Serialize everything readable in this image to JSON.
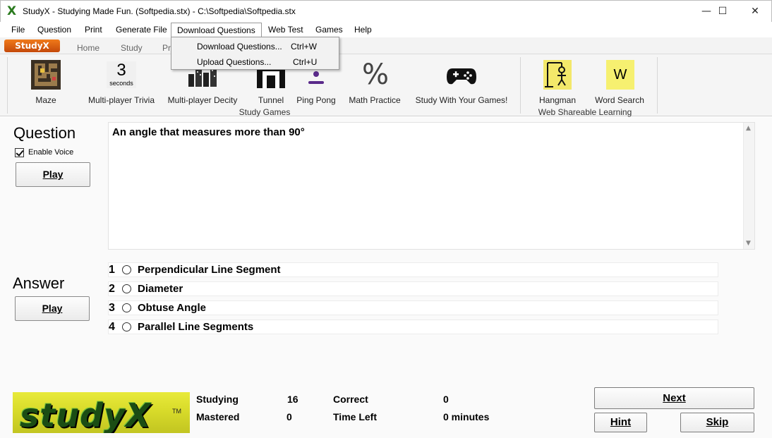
{
  "window": {
    "title": "StudyX - Studying Made Fun. (Softpedia.stx) - C:\\Softpedia\\Softpedia.stx",
    "minimize": "—",
    "maximize": "☐",
    "close": "✕"
  },
  "menu": {
    "items": [
      "File",
      "Question",
      "Print",
      "Generate File",
      "Download Questions",
      "Web Test",
      "Games",
      "Help"
    ],
    "dropdown": [
      {
        "label": "Download Questions...",
        "shortcut": "Ctrl+W"
      },
      {
        "label": "Upload Questions...",
        "shortcut": "Ctrl+U"
      }
    ]
  },
  "ribbon": {
    "brand": "StudyX",
    "tabs": [
      "Home",
      "Study",
      "Pr"
    ],
    "study_games": {
      "group_label": "Study Games",
      "buttons": [
        {
          "label": "Maze",
          "icon": "maze-icon"
        },
        {
          "label": "Multi-player Trivia",
          "icon": "timer-icon",
          "timer_value": "3",
          "timer_unit": "seconds"
        },
        {
          "label": "Multi-player Decity",
          "icon": "city-icon"
        },
        {
          "label": "Tunnel",
          "icon": "tunnel-icon"
        },
        {
          "label": "Ping Pong",
          "icon": "ping-pong-icon"
        },
        {
          "label": "Math Practice",
          "icon": "percent-icon",
          "glyph": "%"
        },
        {
          "label": "Study With Your Games!",
          "icon": "gamepad-icon"
        }
      ]
    },
    "web_shareable": {
      "group_label": "Web Shareable Learning",
      "buttons": [
        {
          "label": "Hangman",
          "icon": "hangman-icon"
        },
        {
          "label": "Word Search",
          "icon": "word-search-icon",
          "glyph": "W"
        }
      ]
    }
  },
  "question": {
    "heading": "Question",
    "enable_voice": "Enable Voice",
    "play": "Play",
    "text": "An angle that measures more than 90°"
  },
  "answer": {
    "heading": "Answer",
    "play": "Play",
    "options": [
      {
        "num": "1",
        "text": "Perpendicular Line Segment"
      },
      {
        "num": "2",
        "text": "Diameter"
      },
      {
        "num": "3",
        "text": "Obtuse Angle"
      },
      {
        "num": "4",
        "text": "Parallel Line Segments"
      }
    ]
  },
  "footer": {
    "logo": "studyX",
    "logo_tm": "TM",
    "studying_label": "Studying",
    "studying_value": "16",
    "mastered_label": "Mastered",
    "mastered_value": "0",
    "correct_label": "Correct",
    "correct_value": "0",
    "time_left_label": "Time Left",
    "time_left_value": "0 minutes",
    "next": "Next",
    "hint": "Hint",
    "skip": "Skip"
  }
}
